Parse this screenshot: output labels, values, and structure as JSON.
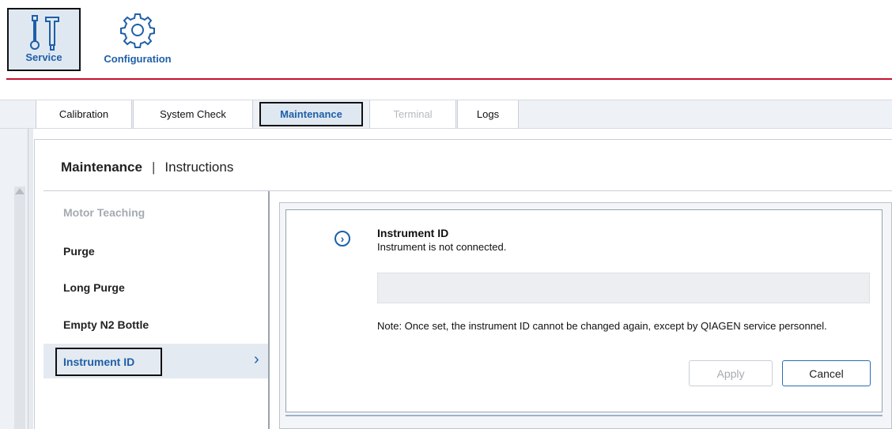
{
  "toolbar": {
    "service_label": "Service",
    "configuration_label": "Configuration",
    "service_icon": "tools-icon",
    "configuration_icon": "gear-icon"
  },
  "tabs": [
    {
      "label": "Calibration",
      "state": "normal"
    },
    {
      "label": "System Check",
      "state": "normal"
    },
    {
      "label": "Maintenance",
      "state": "selected"
    },
    {
      "label": "Terminal",
      "state": "disabled"
    },
    {
      "label": "Logs",
      "state": "normal"
    }
  ],
  "header": {
    "section": "Maintenance",
    "separator": "|",
    "subsection": "Instructions"
  },
  "menu": [
    {
      "label": "Motor Teaching",
      "state": "disabled"
    },
    {
      "label": "Purge",
      "state": "normal"
    },
    {
      "label": "Long Purge",
      "state": "normal"
    },
    {
      "label": "Empty N2 Bottle",
      "state": "normal"
    },
    {
      "label": "Instrument ID",
      "state": "selected"
    }
  ],
  "dialog": {
    "title": "Instrument ID",
    "status": "Instrument is not connected.",
    "input_value": "",
    "note": "Note: Once set, the instrument ID cannot be changed again, except by QIAGEN service personnel.",
    "apply_label": "Apply",
    "cancel_label": "Cancel"
  },
  "colors": {
    "accent": "#1f5fa8",
    "brand_rule": "#c8102e",
    "selected_bg": "#dfe8f1",
    "disabled_text": "#a5aab1"
  }
}
